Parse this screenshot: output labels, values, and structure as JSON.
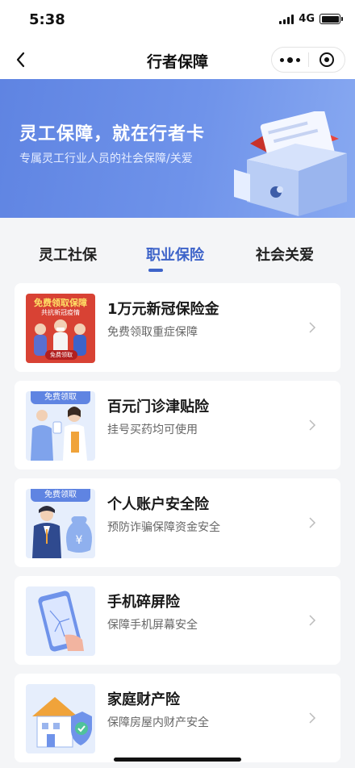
{
  "status": {
    "time": "5:38",
    "network": "4G"
  },
  "nav": {
    "title": "行者保障"
  },
  "banner": {
    "title": "灵工保障，就在行者卡",
    "subtitle": "专属灵工行业人员的社会保障/关爱"
  },
  "tabs": [
    {
      "label": "灵工社保",
      "active": false
    },
    {
      "label": "职业保险",
      "active": true
    },
    {
      "label": "社会关爱",
      "active": false
    }
  ],
  "items": [
    {
      "title": "1万元新冠保险金",
      "desc": "免费领取重症保障",
      "thumb": {
        "badge": "免费领取保障",
        "line2": "共抗新冠疫情",
        "button": "免费领取"
      }
    },
    {
      "title": "百元门诊津贴险",
      "desc": "挂号买药均可使用",
      "thumb": {
        "badge": "免费领取"
      }
    },
    {
      "title": "个人账户安全险",
      "desc": "预防诈骗保障资金安全",
      "thumb": {
        "badge": "免费领取"
      }
    },
    {
      "title": "手机碎屏险",
      "desc": "保障手机屏幕安全"
    },
    {
      "title": "家庭财产险",
      "desc": "保障房屋内财产安全"
    }
  ],
  "colors": {
    "accent": "#3d63c9",
    "banner": "#6f93ea"
  }
}
